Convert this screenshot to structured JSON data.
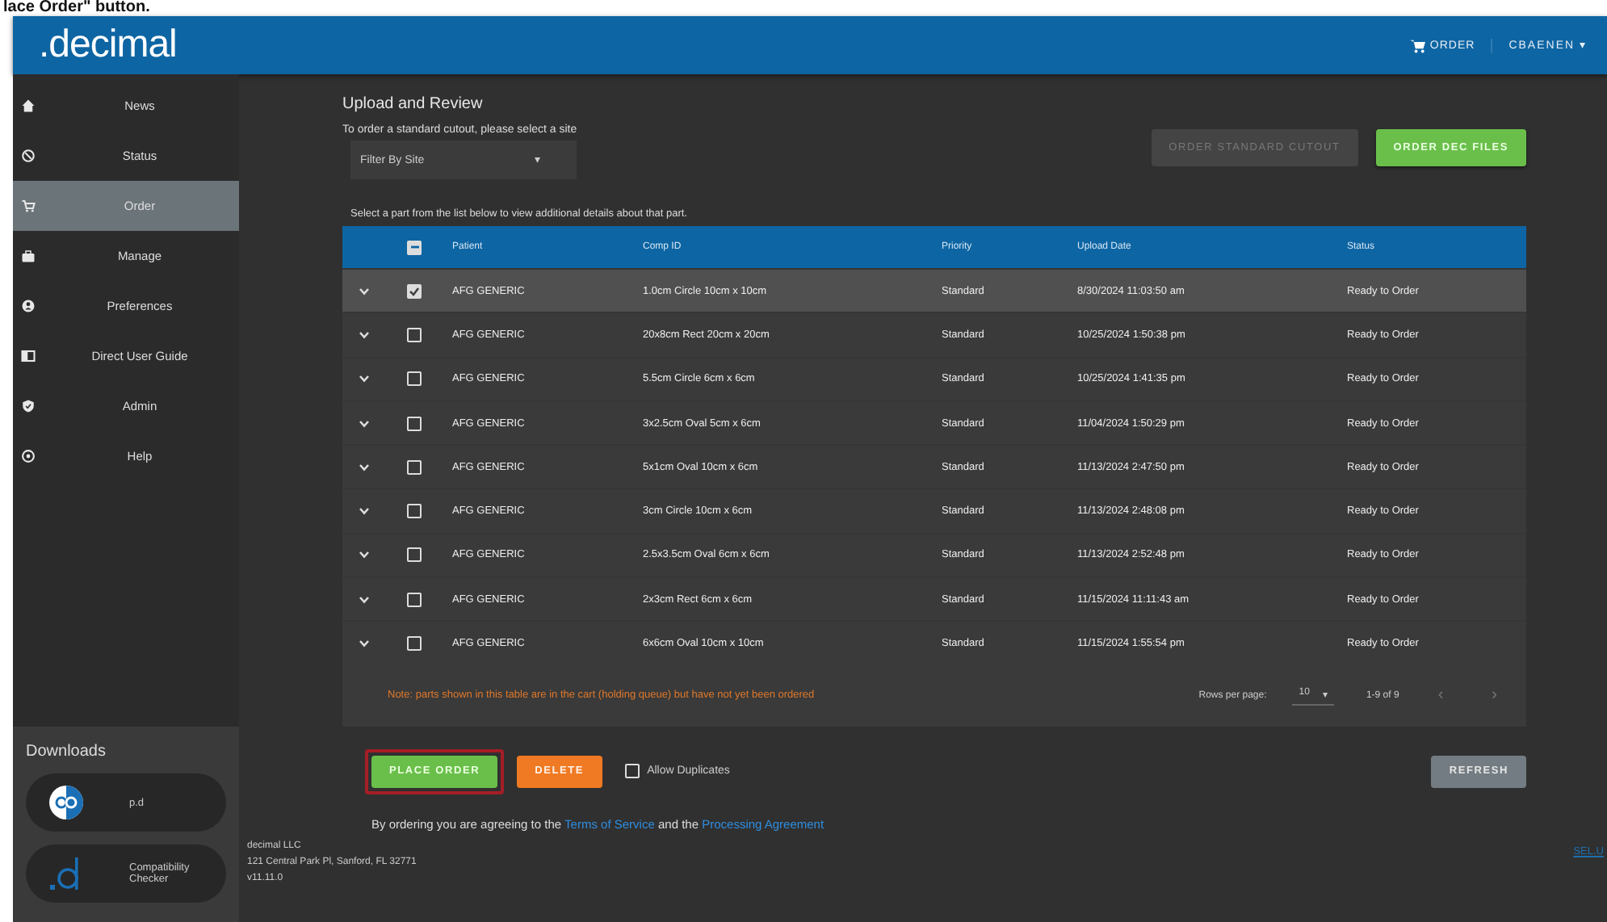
{
  "caption": "lace Order\" button.",
  "header": {
    "logo": ".decimal",
    "cart_label": "ORDER",
    "user": "CBAENEN",
    "user_caret": "▾"
  },
  "sidebar": {
    "items": [
      {
        "label": "News",
        "selected": false
      },
      {
        "label": "Status",
        "selected": false
      },
      {
        "label": "Order",
        "selected": true
      },
      {
        "label": "Manage",
        "selected": false
      },
      {
        "label": "Preferences",
        "selected": false
      },
      {
        "label": "Direct User Guide",
        "selected": false
      },
      {
        "label": "Admin",
        "selected": false
      },
      {
        "label": "Help",
        "selected": false
      }
    ],
    "downloads": {
      "title": "Downloads",
      "items": [
        {
          "kind": "pd",
          "label": "p.d"
        },
        {
          "kind": "d",
          "label": "Compatibility Checker"
        }
      ]
    }
  },
  "main": {
    "title": "Upload and Review",
    "site_prompt": "To order a standard cutout, please select a site",
    "site_select": {
      "placeholder": "Filter By Site",
      "caret": "▾"
    },
    "buttons": [
      {
        "label": "ORDER STANDARD CUTOUT",
        "disabled": true
      },
      {
        "label": "ORDER DEC FILES",
        "disabled": false
      }
    ],
    "table_hint": "Select a part from the list below to view additional details about that part.",
    "table": {
      "header_checked": true,
      "columns": [
        "Patient",
        "Comp ID",
        "Priority",
        "Upload Date",
        "Status"
      ],
      "rows": [
        {
          "selected": true,
          "checked": true,
          "cells": [
            "AFG GENERIC",
            "1.0cm Circle 10cm x 10cm",
            "Standard",
            "8/30/2024 11:03:50 am",
            "Ready to Order"
          ]
        },
        {
          "selected": false,
          "checked": false,
          "cells": [
            "AFG GENERIC",
            "20x8cm Rect 20cm x 20cm",
            "Standard",
            "10/25/2024 1:50:38 pm",
            "Ready to Order"
          ]
        },
        {
          "selected": false,
          "checked": false,
          "cells": [
            "AFG GENERIC",
            "5.5cm Circle 6cm x 6cm",
            "Standard",
            "10/25/2024 1:41:35 pm",
            "Ready to Order"
          ]
        },
        {
          "selected": false,
          "checked": false,
          "cells": [
            "AFG GENERIC",
            "3x2.5cm Oval 5cm x 6cm",
            "Standard",
            "11/04/2024 1:50:29 pm",
            "Ready to Order"
          ]
        },
        {
          "selected": false,
          "checked": false,
          "cells": [
            "AFG GENERIC",
            "5x1cm Oval 10cm x 6cm",
            "Standard",
            "11/13/2024 2:47:50 pm",
            "Ready to Order"
          ]
        },
        {
          "selected": false,
          "checked": false,
          "cells": [
            "AFG GENERIC",
            "3cm Circle 10cm x 6cm",
            "Standard",
            "11/13/2024 2:48:08 pm",
            "Ready to Order"
          ]
        },
        {
          "selected": false,
          "checked": false,
          "cells": [
            "AFG GENERIC",
            "2.5x3.5cm Oval 6cm x 6cm",
            "Standard",
            "11/13/2024 2:52:48 pm",
            "Ready to Order"
          ]
        },
        {
          "selected": false,
          "checked": false,
          "cells": [
            "AFG GENERIC",
            "2x3cm Rect 6cm x 6cm",
            "Standard",
            "11/15/2024 11:11:43 am",
            "Ready to Order"
          ]
        },
        {
          "selected": false,
          "checked": false,
          "cells": [
            "AFG GENERIC",
            "6x6cm Oval 10cm x 10cm",
            "Standard",
            "11/15/2024 1:55:54 pm",
            "Ready to Order"
          ]
        }
      ],
      "note": "Note: parts shown in this table are in the cart (holding queue) but have not yet been ordered",
      "pagination": {
        "rows_label": "Rows per page:",
        "rows_value": "10",
        "caret": "▾",
        "range": "1-9 of 9",
        "prev": "‹",
        "next": "›"
      }
    },
    "actions": [
      {
        "kind": "place",
        "label": "PLACE ORDER",
        "highlighted": true
      },
      {
        "kind": "delete",
        "label": "DELETE",
        "highlighted": false
      }
    ],
    "allow_duplicates": {
      "label": "Allow Duplicates",
      "checked": false
    },
    "refresh": "REFRESH",
    "terms": {
      "before": "By ordering you are agreeing to the",
      "link1": "Terms of Service",
      "middle": "and the",
      "link2": "Processing Agreement"
    },
    "footer": [
      "decimal LLC",
      "121 Central Park Pl, Sanford, FL 32771",
      "v11.11.0"
    ],
    "corner_link": "SEL.U"
  }
}
